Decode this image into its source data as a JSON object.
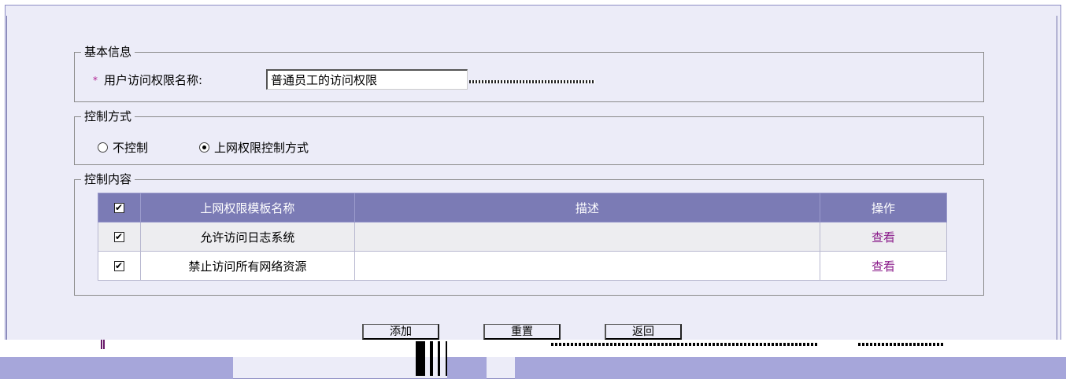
{
  "basic_info": {
    "legend": "基本信息",
    "required_mark": "*",
    "field_label": "用户访问权限名称:",
    "field_value": "普通员工的访问权限"
  },
  "control_mode": {
    "legend": "控制方式",
    "options": [
      {
        "label": "不控制",
        "selected": false
      },
      {
        "label": "上网权限控制方式",
        "selected": true
      }
    ]
  },
  "control_content": {
    "legend": "控制内容",
    "table": {
      "header_checked": true,
      "columns": [
        "上网权限模板名称",
        "描述",
        "操作"
      ],
      "rows": [
        {
          "checked": true,
          "name": "允许访问日志系统",
          "description": "",
          "action": "查看"
        },
        {
          "checked": true,
          "name": "禁止访问所有网络资源",
          "description": "",
          "action": "查看"
        }
      ]
    }
  },
  "buttons": {
    "add": "添加",
    "reset": "重置",
    "back": "返回"
  },
  "colors": {
    "panel_bg": "#ececf8",
    "table_header": "#7b7bb5",
    "link": "#8a1c8a",
    "bar": "#a6a6da"
  }
}
